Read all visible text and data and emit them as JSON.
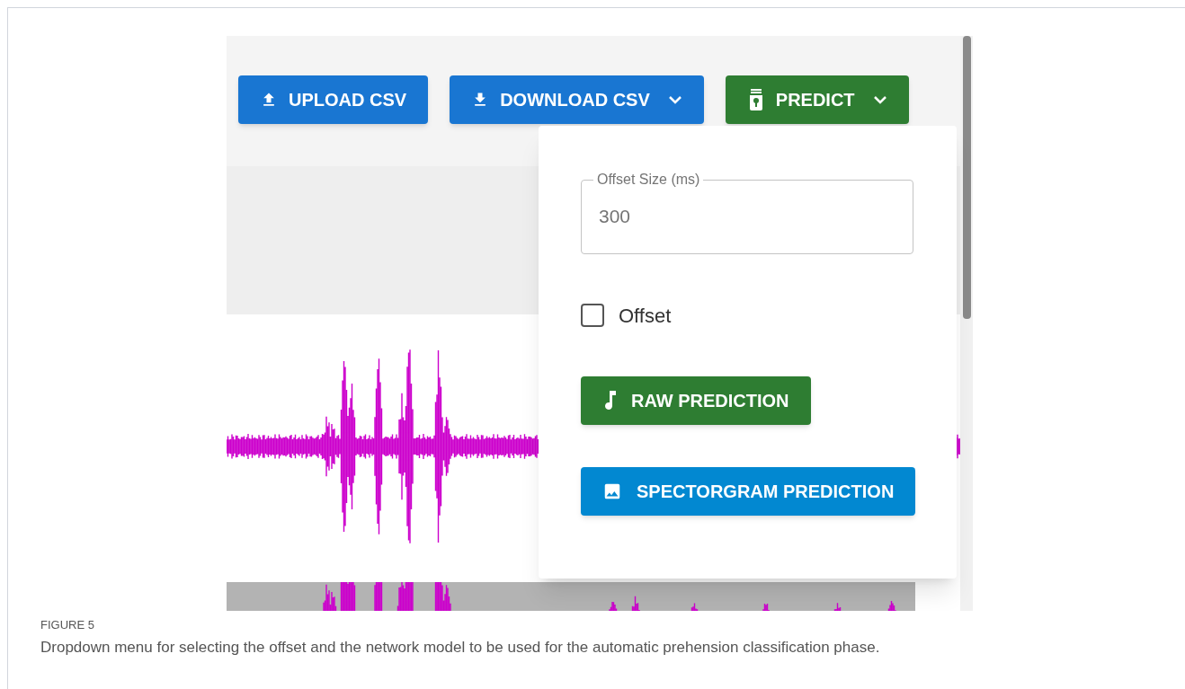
{
  "toolbar": {
    "buttons": [
      {
        "label": "UPLOAD CSV",
        "kind": "upload",
        "caret": false,
        "color": "#1976d2"
      },
      {
        "label": "DOWNLOAD CSV",
        "kind": "download",
        "caret": true,
        "color": "#1976d2"
      },
      {
        "label": "PREDICT",
        "kind": "predict",
        "caret": true,
        "color": "#2e7d32"
      }
    ]
  },
  "predict_menu": {
    "offset_field": {
      "label": "Offset Size (ms)",
      "value": "300"
    },
    "offset_checkbox": {
      "label": "Offset",
      "checked": false
    },
    "buttons": [
      {
        "label": "RAW PREDICTION",
        "kind": "raw",
        "color": "#2e7d32"
      },
      {
        "label": "SPECTORGRAM PREDICTION",
        "kind": "spectrogram",
        "color": "#0288d1"
      }
    ]
  },
  "caption": {
    "figure": "FIGURE 5",
    "text": "Dropdown menu for selecting the offset and the network model to be used for the automatic prehension classification phase."
  }
}
